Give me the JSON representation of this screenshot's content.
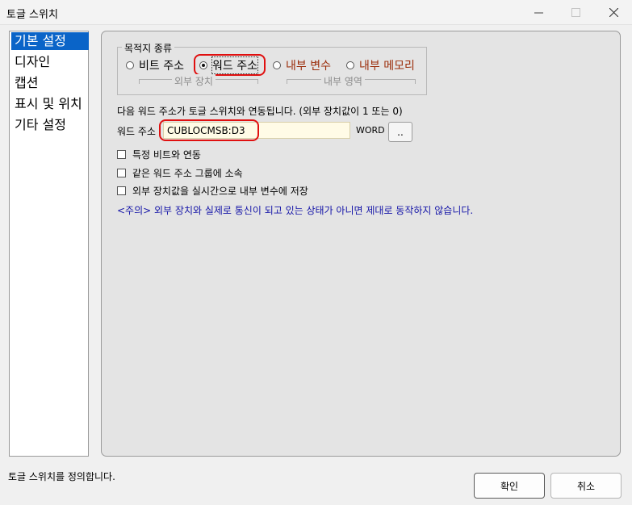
{
  "window": {
    "title": "토글 스위치",
    "controls": {
      "minimize_icon": "minimize-icon",
      "maximize_icon": "maximize-icon",
      "close_icon": "close-icon"
    }
  },
  "nav": {
    "items": [
      {
        "label": "기본 설정",
        "selected": true
      },
      {
        "label": "디자인",
        "selected": false
      },
      {
        "label": "캡션",
        "selected": false
      },
      {
        "label": "표시 및 위치",
        "selected": false
      },
      {
        "label": "기타 설정",
        "selected": false
      }
    ]
  },
  "target": {
    "legend": "목적지 종류",
    "options": [
      {
        "label": "비트 주소",
        "checked": false
      },
      {
        "label": "워드 주소",
        "checked": true
      },
      {
        "label": "내부 변수",
        "checked": false
      },
      {
        "label": "내부 메모리",
        "checked": false
      }
    ],
    "group_external": "외부 장치",
    "group_internal": "내부 영역",
    "highlight_color": "#e01010",
    "internal_color": "#9b2d0a"
  },
  "description": "다음 워드 주소가 토글 스위치와 연동됩니다. (외부 장치값이 1 또는 0)",
  "address": {
    "label": "워드 주소",
    "value": "CUBLOCMSB:D3",
    "unit": "WORD",
    "browse_label": ".."
  },
  "checkboxes": [
    {
      "label": "특정 비트와 연동",
      "checked": false
    },
    {
      "label": "같은 워드 주소 그룹에 소속",
      "checked": false
    },
    {
      "label": "외부 장치값을 실시간으로 내부 변수에 저장",
      "checked": false
    }
  ],
  "caution": "<주의> 외부 장치와 실제로 통신이 되고 있는 상태가 아니면 제대로 동작하지 않습니다.",
  "status": "토글 스위치를 정의합니다.",
  "buttons": {
    "ok": "확인",
    "cancel": "취소"
  }
}
